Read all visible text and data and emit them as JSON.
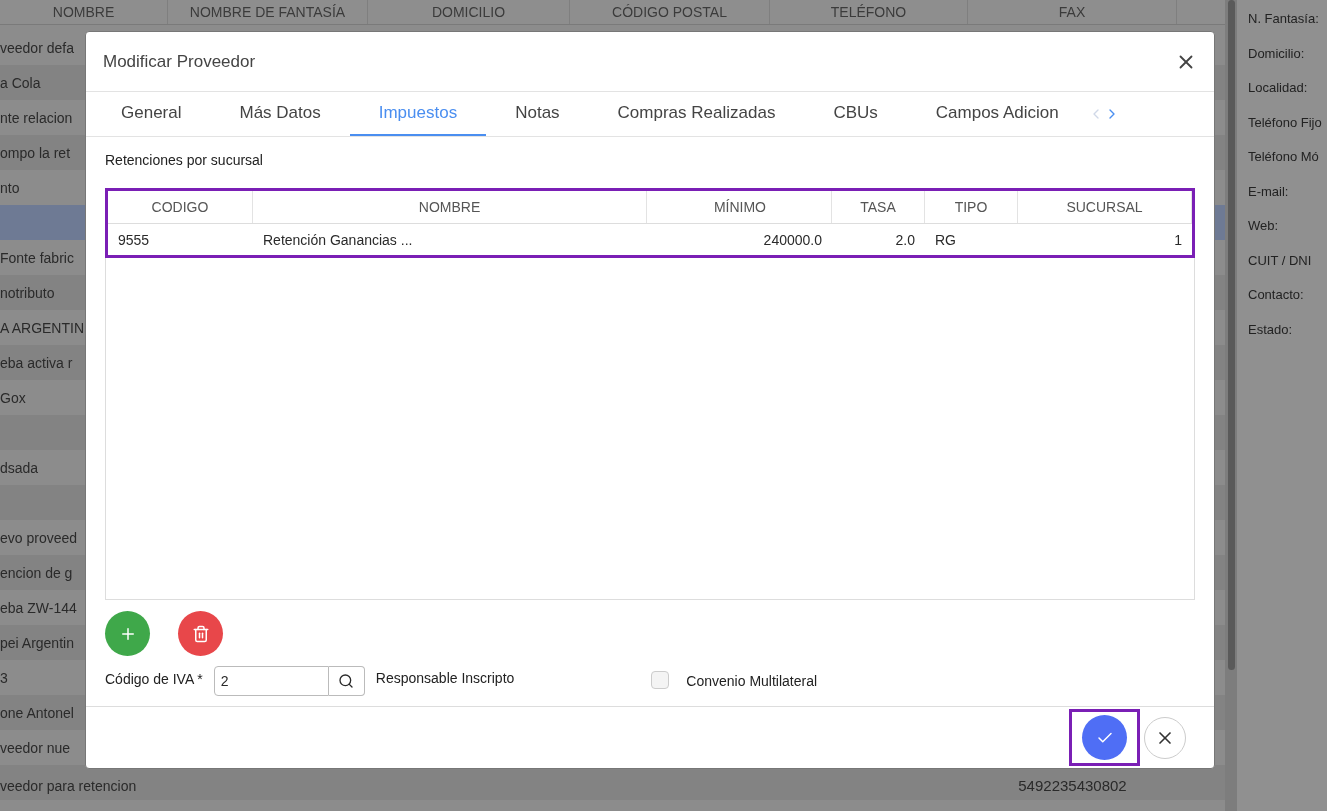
{
  "background_table": {
    "columns": [
      "NOMBRE",
      "NOMBRE DE FANTASÍA",
      "DOMICILIO",
      "CÓDIGO POSTAL",
      "TELÉFONO",
      "FAX"
    ],
    "rows": [
      {
        "name": "veedor defa",
        "selected": false
      },
      {
        "name": "a Cola",
        "selected": false
      },
      {
        "name": "nte relacion",
        "selected": false
      },
      {
        "name": "ompo la ret",
        "selected": false
      },
      {
        "name": "nto",
        "selected": false
      },
      {
        "name": "",
        "selected": true
      },
      {
        "name": "Fonte fabric",
        "selected": false
      },
      {
        "name": "notributo",
        "selected": false
      },
      {
        "name": "A ARGENTIN",
        "selected": false
      },
      {
        "name": "eba activa r",
        "selected": false
      },
      {
        "name": "Gox",
        "selected": false
      },
      {
        "name": "",
        "selected": false
      },
      {
        "name": "dsada",
        "selected": false
      },
      {
        "name": "",
        "selected": false
      },
      {
        "name": "evo proveed",
        "selected": false
      },
      {
        "name": "encion de g",
        "selected": false
      },
      {
        "name": "eba ZW-144",
        "selected": false
      },
      {
        "name": "pei Argentin",
        "selected": false
      },
      {
        "name": "3",
        "selected": false
      },
      {
        "name": "one Antonel",
        "selected": false
      },
      {
        "name": "veedor nue",
        "selected": false
      },
      {
        "name": "veedor para retencion",
        "fax": "5492235430802",
        "selected": false
      }
    ]
  },
  "detail_panel": {
    "labels": [
      "N. Fantasía:",
      "Domicilio:",
      "Localidad:",
      "Teléfono Fijo",
      "Teléfono Mó",
      "E-mail:",
      "Web:",
      "CUIT / DNI",
      "Contacto:",
      "Estado:"
    ]
  },
  "dialog": {
    "title": "Modificar Proveedor",
    "tabs": [
      {
        "label": "General",
        "selected": false
      },
      {
        "label": "Más Datos",
        "selected": false
      },
      {
        "label": "Impuestos",
        "selected": true
      },
      {
        "label": "Notas",
        "selected": false
      },
      {
        "label": "Compras Realizadas",
        "selected": false
      },
      {
        "label": "CBUs",
        "selected": false
      },
      {
        "label": "Campos Adicion",
        "selected": false
      }
    ],
    "section_title": "Retenciones por sucursal",
    "table": {
      "columns": [
        "CODIGO",
        "NOMBRE",
        "MÍNIMO",
        "TASA",
        "TIPO",
        "SUCURSAL"
      ],
      "rows": [
        {
          "cells": [
            "9555",
            "Retención Ganancias ...",
            "240000.0",
            "2.0",
            "RG",
            "1"
          ]
        }
      ]
    },
    "iva": {
      "label": "Código de IVA *",
      "value": "2",
      "description": "Responsable Inscripto"
    },
    "convenio": {
      "label": "Convenio Multilateral",
      "checked": false
    }
  }
}
